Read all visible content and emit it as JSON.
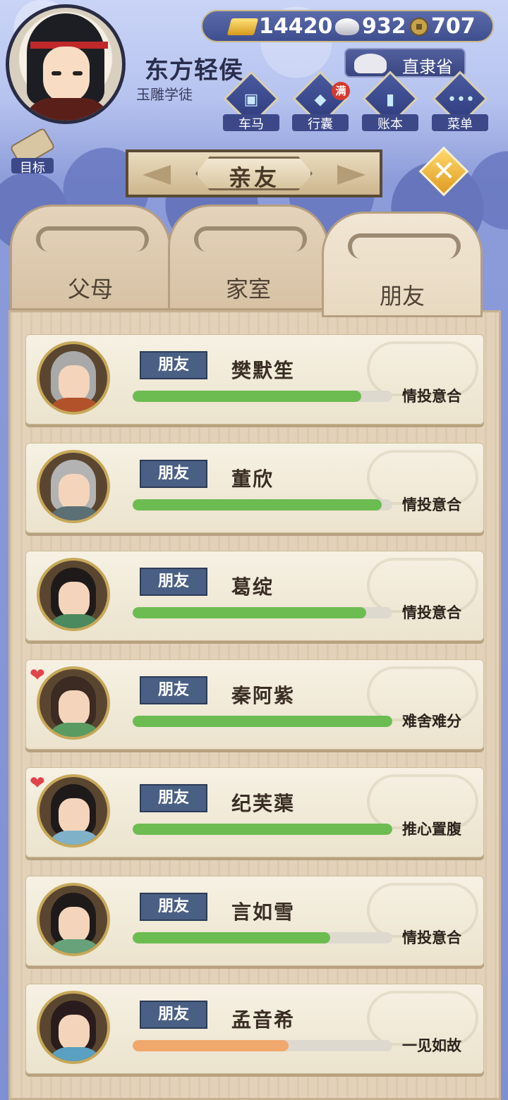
{
  "currency": {
    "gold": "14420",
    "silver": "932",
    "copper": "707"
  },
  "player": {
    "name": "东方轻侯",
    "title": "玉雕学徒",
    "location": "直隶省"
  },
  "menu": [
    {
      "label": "车马",
      "icon": "carriage-icon"
    },
    {
      "label": "行囊",
      "icon": "bag-icon",
      "badge": "满"
    },
    {
      "label": "账本",
      "icon": "ledger-icon"
    },
    {
      "label": "菜单",
      "icon": "more-icon"
    }
  ],
  "goal_label": "目标",
  "page_title": "亲友",
  "tabs": [
    {
      "label": "父母",
      "active": false
    },
    {
      "label": "家室",
      "active": false
    },
    {
      "label": "朋友",
      "active": true
    }
  ],
  "colors": {
    "bar_green": "#6cbc52",
    "bar_orange": "#f0a86c",
    "badge_blue": "#4a5f84"
  },
  "friends": [
    {
      "relation": "朋友",
      "name": "樊默笙",
      "status": "情投意合",
      "progress": 0.88,
      "bar": "green",
      "hearts": false,
      "hair": "#a9a9a9",
      "cloth": "#b2522b"
    },
    {
      "relation": "朋友",
      "name": "董欣",
      "status": "情投意合",
      "progress": 0.96,
      "bar": "green",
      "hearts": false,
      "hair": "#b3b3b3",
      "cloth": "#5b6f74"
    },
    {
      "relation": "朋友",
      "name": "葛绽",
      "status": "情投意合",
      "progress": 0.9,
      "bar": "green",
      "hearts": false,
      "hair": "#1f1a1a",
      "cloth": "#4b8a5e"
    },
    {
      "relation": "朋友",
      "name": "秦阿紫",
      "status": "难舍难分",
      "progress": 1.0,
      "bar": "green",
      "hearts": true,
      "hair": "#3b2b22",
      "cloth": "#5a9b62"
    },
    {
      "relation": "朋友",
      "name": "纪芙蕖",
      "status": "推心置腹",
      "progress": 1.0,
      "bar": "green",
      "hearts": true,
      "hair": "#1f1a1a",
      "cloth": "#7fb2c9"
    },
    {
      "relation": "朋友",
      "name": "言如雪",
      "status": "情投意合",
      "progress": 0.76,
      "bar": "green",
      "hearts": false,
      "hair": "#1f1a1a",
      "cloth": "#68a27a"
    },
    {
      "relation": "朋友",
      "name": "孟音希",
      "status": "一见如故",
      "progress": 0.6,
      "bar": "orange",
      "hearts": false,
      "hair": "#2a1c1c",
      "cloth": "#5aa0c0"
    }
  ]
}
